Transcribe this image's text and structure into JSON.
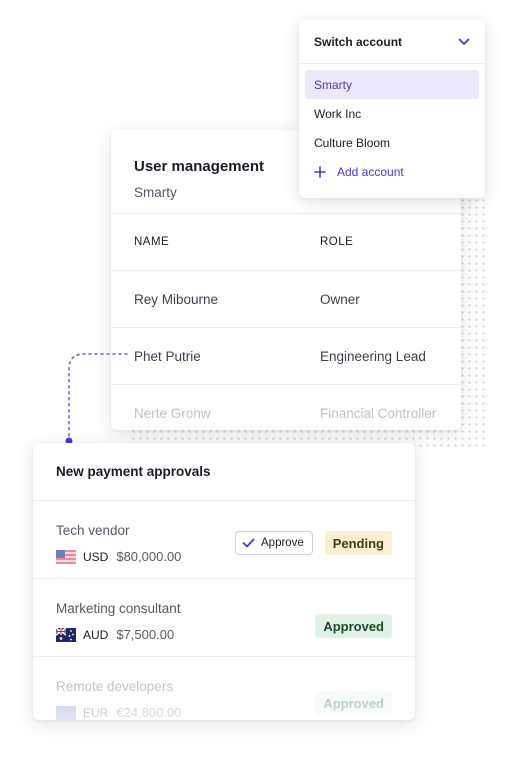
{
  "switch_account": {
    "title": "Switch account",
    "items": [
      "Smarty",
      "Work Inc",
      "Culture Bloom"
    ],
    "selected": "Smarty",
    "add_label": "Add account"
  },
  "user_management": {
    "title": "User management",
    "subtitle": "Smarty",
    "columns": [
      "NAME",
      "ROLE"
    ],
    "rows": [
      {
        "name": "Rey Mibourne",
        "role": "Owner"
      },
      {
        "name": "Phet Putrie",
        "role": "Engineering Lead"
      },
      {
        "name": "Nerte Gronw",
        "role": "Financial Controller"
      }
    ]
  },
  "payments": {
    "title": "New payment approvals",
    "approve_label": "Approve",
    "entries": [
      {
        "name": "Tech vendor",
        "currency": "USD",
        "amount": "$80,000.00",
        "status": "Pending"
      },
      {
        "name": "Marketing consultant",
        "currency": "AUD",
        "amount": "$7,500.00",
        "status": "Approved"
      },
      {
        "name": "Remote developers",
        "currency": "EUR",
        "amount": "€24,800.00",
        "status": "Approved"
      }
    ]
  },
  "colors": {
    "accent": "#5533c8",
    "pending_bg": "#fdf0d2",
    "approved_bg": "#e0f2e6"
  }
}
